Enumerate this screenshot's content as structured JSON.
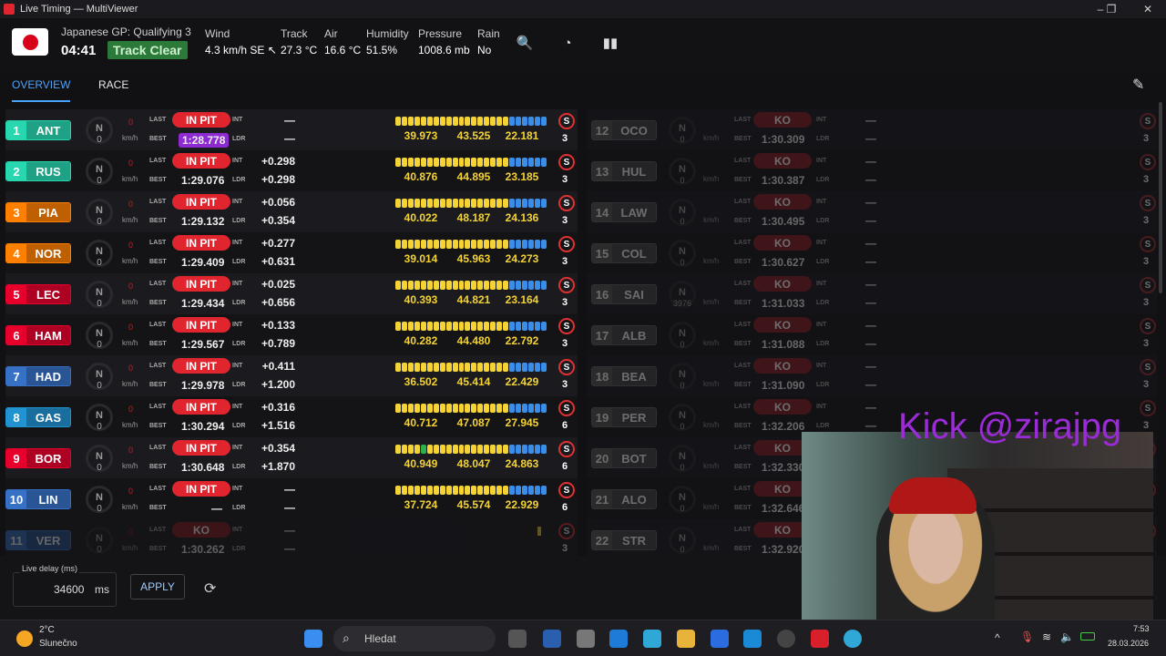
{
  "window": {
    "title": "Live Timing — MultiViewer"
  },
  "session": {
    "name": "Japanese GP: Qualifying 3",
    "clock": "04:41",
    "status": "Track Clear"
  },
  "weather": [
    {
      "label": "Wind",
      "value": "4.3 km/h SE ↖"
    },
    {
      "label": "Track",
      "value": "27.3 °C"
    },
    {
      "label": "Air",
      "value": "16.6 °C"
    },
    {
      "label": "Humidity",
      "value": "51.5%"
    },
    {
      "label": "Pressure",
      "value": "1008.6 mb"
    },
    {
      "label": "Rain",
      "value": "No"
    }
  ],
  "tabs": [
    {
      "label": "OVERVIEW"
    },
    {
      "label": "RACE"
    }
  ],
  "labels": {
    "last": "LAST",
    "best": "BEST",
    "int": "INT",
    "ldr": "LDR",
    "kmh": "km/h",
    "gearN": "N"
  },
  "left_drivers": [
    {
      "pos": "1",
      "code": "ANT",
      "color": "#28d6b0",
      "gear": "0",
      "speed": "0",
      "last": "IN PIT",
      "best": "1:28.778",
      "best_purple": true,
      "int": "—",
      "ldr": "—",
      "s1": "39.973",
      "s2": "43.525",
      "s3": "22.181",
      "tyre": "S",
      "laps": "3"
    },
    {
      "pos": "2",
      "code": "RUS",
      "color": "#28d6b0",
      "gear": "0",
      "speed": "0",
      "last": "IN PIT",
      "best": "1:29.076",
      "int": "+0.298",
      "ldr": "+0.298",
      "s1": "40.876",
      "s2": "44.895",
      "s3": "23.185",
      "tyre": "S",
      "laps": "3"
    },
    {
      "pos": "3",
      "code": "PIA",
      "color": "#ff8000",
      "gear": "0",
      "speed": "0",
      "last": "IN PIT",
      "best": "1:29.132",
      "int": "+0.056",
      "ldr": "+0.354",
      "s1": "40.022",
      "s2": "48.187",
      "s3": "24.136",
      "tyre": "S",
      "laps": "3"
    },
    {
      "pos": "4",
      "code": "NOR",
      "color": "#ff8000",
      "gear": "0",
      "speed": "0",
      "last": "IN PIT",
      "best": "1:29.409",
      "int": "+0.277",
      "ldr": "+0.631",
      "s1": "39.014",
      "s2": "45.963",
      "s3": "24.273",
      "tyre": "S",
      "laps": "3"
    },
    {
      "pos": "5",
      "code": "LEC",
      "color": "#e8002d",
      "gear": "0",
      "speed": "0",
      "last": "IN PIT",
      "best": "1:29.434",
      "int": "+0.025",
      "ldr": "+0.656",
      "s1": "40.393",
      "s2": "44.821",
      "s3": "23.164",
      "tyre": "S",
      "laps": "3"
    },
    {
      "pos": "6",
      "code": "HAM",
      "color": "#e8002d",
      "gear": "0",
      "speed": "0",
      "last": "IN PIT",
      "best": "1:29.567",
      "int": "+0.133",
      "ldr": "+0.789",
      "s1": "40.282",
      "s2": "44.480",
      "s3": "22.792",
      "tyre": "S",
      "laps": "3"
    },
    {
      "pos": "7",
      "code": "HAD",
      "color": "#3671c6",
      "gear": "0",
      "speed": "0",
      "last": "IN PIT",
      "best": "1:29.978",
      "int": "+0.411",
      "ldr": "+1.200",
      "s1": "36.502",
      "s2": "45.414",
      "s3": "22.429",
      "tyre": "S",
      "laps": "3"
    },
    {
      "pos": "8",
      "code": "GAS",
      "color": "#2293d1",
      "gear": "0",
      "speed": "0",
      "last": "IN PIT",
      "best": "1:30.294",
      "int": "+0.316",
      "ldr": "+1.516",
      "s1": "40.712",
      "s2": "47.087",
      "s3": "27.945",
      "tyre": "S",
      "laps": "6"
    },
    {
      "pos": "9",
      "code": "BOR",
      "color": "#e8002d",
      "gear": "0",
      "speed": "0",
      "last": "IN PIT",
      "best": "1:30.648",
      "int": "+0.354",
      "ldr": "+1.870",
      "s1": "40.949",
      "s2": "48.047",
      "s3": "24.863",
      "tyre": "S",
      "laps": "6"
    },
    {
      "pos": "10",
      "code": "LIN",
      "color": "#3671c6",
      "gear": "0",
      "speed": "0",
      "last": "IN PIT",
      "best": "—",
      "int": "—",
      "ldr": "—",
      "s1": "37.724",
      "s2": "45.574",
      "s3": "22.929",
      "tyre": "S",
      "laps": "6"
    },
    {
      "pos": "11",
      "code": "VER",
      "color": "#3671c6",
      "gear": "0",
      "speed": "0",
      "last": "KO",
      "best": "1:30.262",
      "int": "—",
      "ldr": "—",
      "s1": "",
      "s2": "",
      "s3": "",
      "tyre": "S",
      "laps": "3",
      "dim": true
    }
  ],
  "right_drivers": [
    {
      "pos": "12",
      "code": "OCO",
      "gear": "0",
      "best": "1:30.309"
    },
    {
      "pos": "13",
      "code": "HUL",
      "gear": "0",
      "best": "1:30.387"
    },
    {
      "pos": "14",
      "code": "LAW",
      "gear": "0",
      "best": "1:30.495"
    },
    {
      "pos": "15",
      "code": "COL",
      "gear": "0",
      "best": "1:30.627"
    },
    {
      "pos": "16",
      "code": "SAI",
      "gear": "3976",
      "best": "1:31.033"
    },
    {
      "pos": "17",
      "code": "ALB",
      "gear": "0",
      "best": "1:31.088"
    },
    {
      "pos": "18",
      "code": "BEA",
      "gear": "0",
      "best": "1:31.090"
    },
    {
      "pos": "19",
      "code": "PER",
      "gear": "0",
      "best": "1:32.206"
    },
    {
      "pos": "20",
      "code": "BOT",
      "gear": "0",
      "best": "1:32.330"
    },
    {
      "pos": "21",
      "code": "ALO",
      "gear": "0",
      "best": "1:32.646"
    },
    {
      "pos": "22",
      "code": "STR",
      "gear": "0",
      "best": "1:32.920"
    }
  ],
  "right_common": {
    "last": "KO",
    "int": "—",
    "ldr": "—",
    "tyre": "S",
    "laps": "3"
  },
  "footer": {
    "delay_label": "Live delay (ms)",
    "delay_value": "34600",
    "delay_unit": "ms",
    "apply": "APPLY"
  },
  "overlay": {
    "kick": "Kick @zirajpg"
  },
  "taskbar": {
    "temp": "2°C",
    "weather": "Slunečno",
    "search_placeholder": "Hledat",
    "time": "7:53",
    "date": "28.03.2026"
  },
  "colors": {
    "in_pit": "#e0252f",
    "purple": "#8e2ad2",
    "sector_yellow": "#f3d335",
    "sector_blue": "#3b8ee8",
    "accent": "#4aa3ff"
  }
}
